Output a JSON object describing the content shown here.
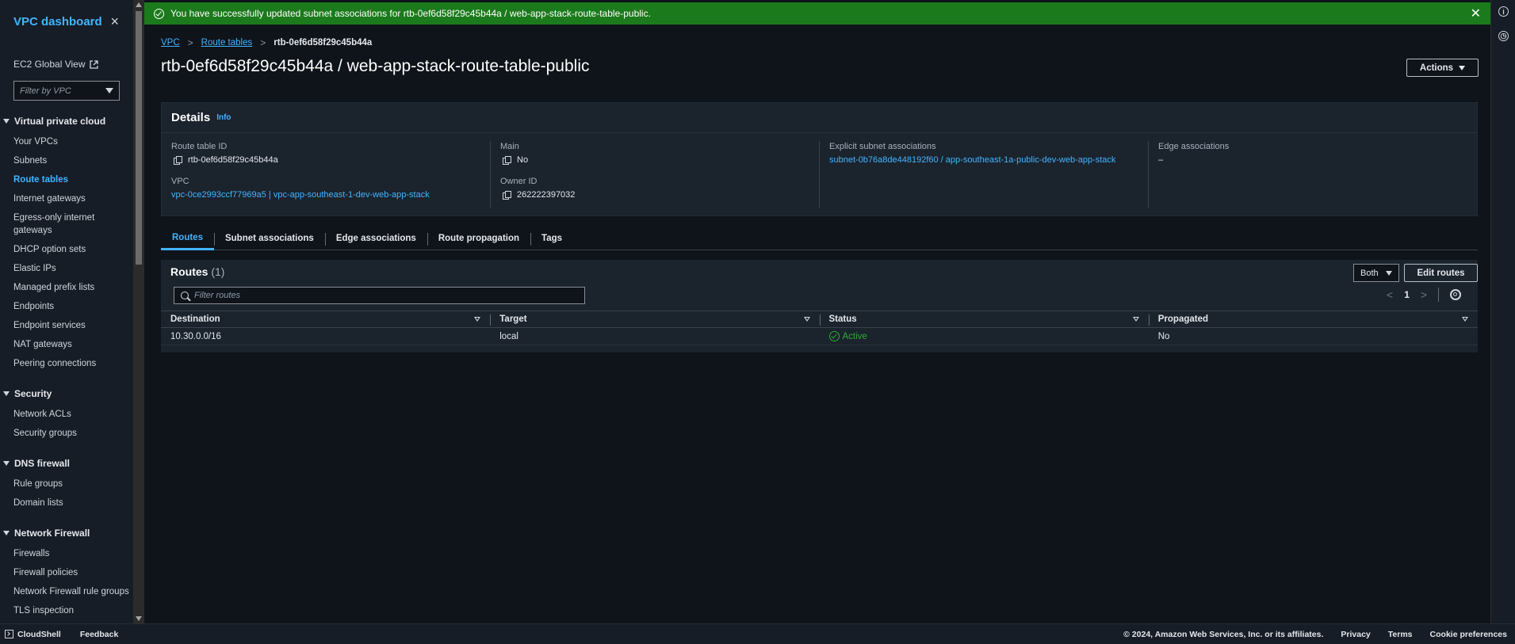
{
  "sidebar": {
    "title": "VPC dashboard",
    "close_icon": "×",
    "global_view": "EC2 Global View",
    "filter_placeholder": "Filter by VPC",
    "sections": [
      {
        "label": "Virtual private cloud",
        "items": [
          "Your VPCs",
          "Subnets",
          "Route tables",
          "Internet gateways",
          "Egress-only internet gateways",
          "DHCP option sets",
          "Elastic IPs",
          "Managed prefix lists",
          "Endpoints",
          "Endpoint services",
          "NAT gateways",
          "Peering connections"
        ]
      },
      {
        "label": "Security",
        "items": [
          "Network ACLs",
          "Security groups"
        ]
      },
      {
        "label": "DNS firewall",
        "items": [
          "Rule groups",
          "Domain lists"
        ]
      },
      {
        "label": "Network Firewall",
        "items": [
          "Firewalls",
          "Firewall policies",
          "Network Firewall rule groups",
          "TLS inspection"
        ]
      }
    ],
    "active_item": "Route tables"
  },
  "flash": {
    "message": "You have successfully updated subnet associations for rtb-0ef6d58f29c45b44a / web-app-stack-route-table-public.",
    "close": "✕"
  },
  "breadcrumb": {
    "items": [
      "VPC",
      "Route tables"
    ],
    "current": "rtb-0ef6d58f29c45b44a"
  },
  "page": {
    "title": "rtb-0ef6d58f29c45b44a / web-app-stack-route-table-public",
    "actions_label": "Actions"
  },
  "details": {
    "heading": "Details",
    "info": "Info",
    "route_table_id_label": "Route table ID",
    "route_table_id": "rtb-0ef6d58f29c45b44a",
    "vpc_label": "VPC",
    "vpc_value": "vpc-0ce2993ccf77969a5 | vpc-app-southeast-1-dev-web-app-stack",
    "main_label": "Main",
    "main_value": "No",
    "owner_label": "Owner ID",
    "owner_value": "262222397032",
    "explicit_label": "Explicit subnet associations",
    "explicit_value": "subnet-0b76a8de448192f60 / app-southeast-1a-public-dev-web-app-stack",
    "edge_label": "Edge associations",
    "edge_value": "–"
  },
  "tabs": [
    "Routes",
    "Subnet associations",
    "Edge associations",
    "Route propagation",
    "Tags"
  ],
  "routes": {
    "title": "Routes",
    "count": "(1)",
    "select_value": "Both",
    "edit_label": "Edit routes",
    "filter_placeholder": "Filter routes",
    "page": "1",
    "columns": [
      "Destination",
      "Target",
      "Status",
      "Propagated"
    ],
    "rows": [
      {
        "destination": "10.30.0.0/16",
        "target": "local",
        "status": "Active",
        "propagated": "No"
      }
    ]
  },
  "footer": {
    "cloudshell": "CloudShell",
    "feedback": "Feedback",
    "copyright": "© 2024, Amazon Web Services, Inc. or its affiliates.",
    "privacy": "Privacy",
    "terms": "Terms",
    "cookies": "Cookie preferences"
  },
  "colors": {
    "accent": "#42b4ff",
    "success_banner": "#1b7a1b",
    "status_ok": "#29ad32"
  }
}
